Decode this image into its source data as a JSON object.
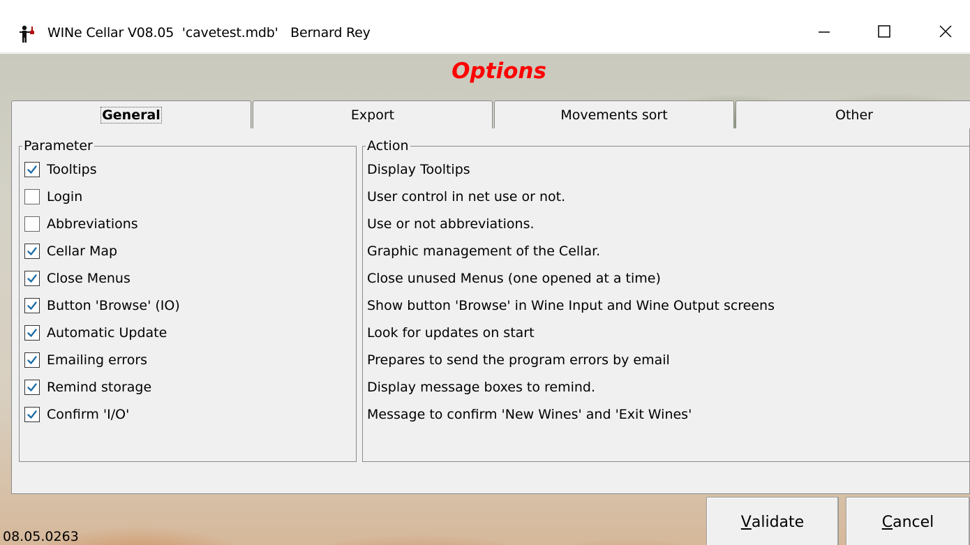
{
  "window": {
    "title": "WINe Cellar V08.05  'cavetest.mdb'   Bernard Rey",
    "icon": "wine-cellar-app-icon",
    "controls": {
      "minimize": "minimize-icon",
      "maximize": "maximize-icon",
      "close": "close-icon"
    }
  },
  "header": {
    "title": "Options",
    "title_color": "#ff0000"
  },
  "tabs": [
    {
      "label": "General",
      "selected": true
    },
    {
      "label": "Export",
      "selected": false
    },
    {
      "label": "Movements sort",
      "selected": false
    },
    {
      "label": "Other",
      "selected": false
    }
  ],
  "parameter_group": {
    "label": "Parameter",
    "items": [
      {
        "label": "Tooltips",
        "checked": true
      },
      {
        "label": "Login",
        "checked": false
      },
      {
        "label": "Abbreviations",
        "checked": false
      },
      {
        "label": "Cellar Map",
        "checked": true
      },
      {
        "label": "Close Menus",
        "checked": true
      },
      {
        "label": "Button 'Browse' (IO)",
        "checked": true
      },
      {
        "label": "Automatic Update",
        "checked": true
      },
      {
        "label": "Emailing errors",
        "checked": true
      },
      {
        "label": "Remind storage",
        "checked": true
      },
      {
        "label": "Confirm 'I/O'",
        "checked": true
      }
    ]
  },
  "action_group": {
    "label": "Action",
    "items": [
      "Display Tooltips",
      "User control in net use or not.",
      "Use or not abbreviations.",
      "Graphic management of the Cellar.",
      "Close unused Menus (one opened at a time)",
      "Show button 'Browse' in Wine Input and Wine Output screens",
      "Look for updates on start",
      "Prepares to send the program errors by email",
      "Display message boxes to remind.",
      "Message to confirm 'New Wines' and 'Exit Wines'"
    ]
  },
  "footer": {
    "version": "08.05.0263",
    "validate": {
      "mnemonic": "V",
      "rest": "alidate"
    },
    "cancel": {
      "mnemonic": "C",
      "rest": "ancel"
    }
  }
}
